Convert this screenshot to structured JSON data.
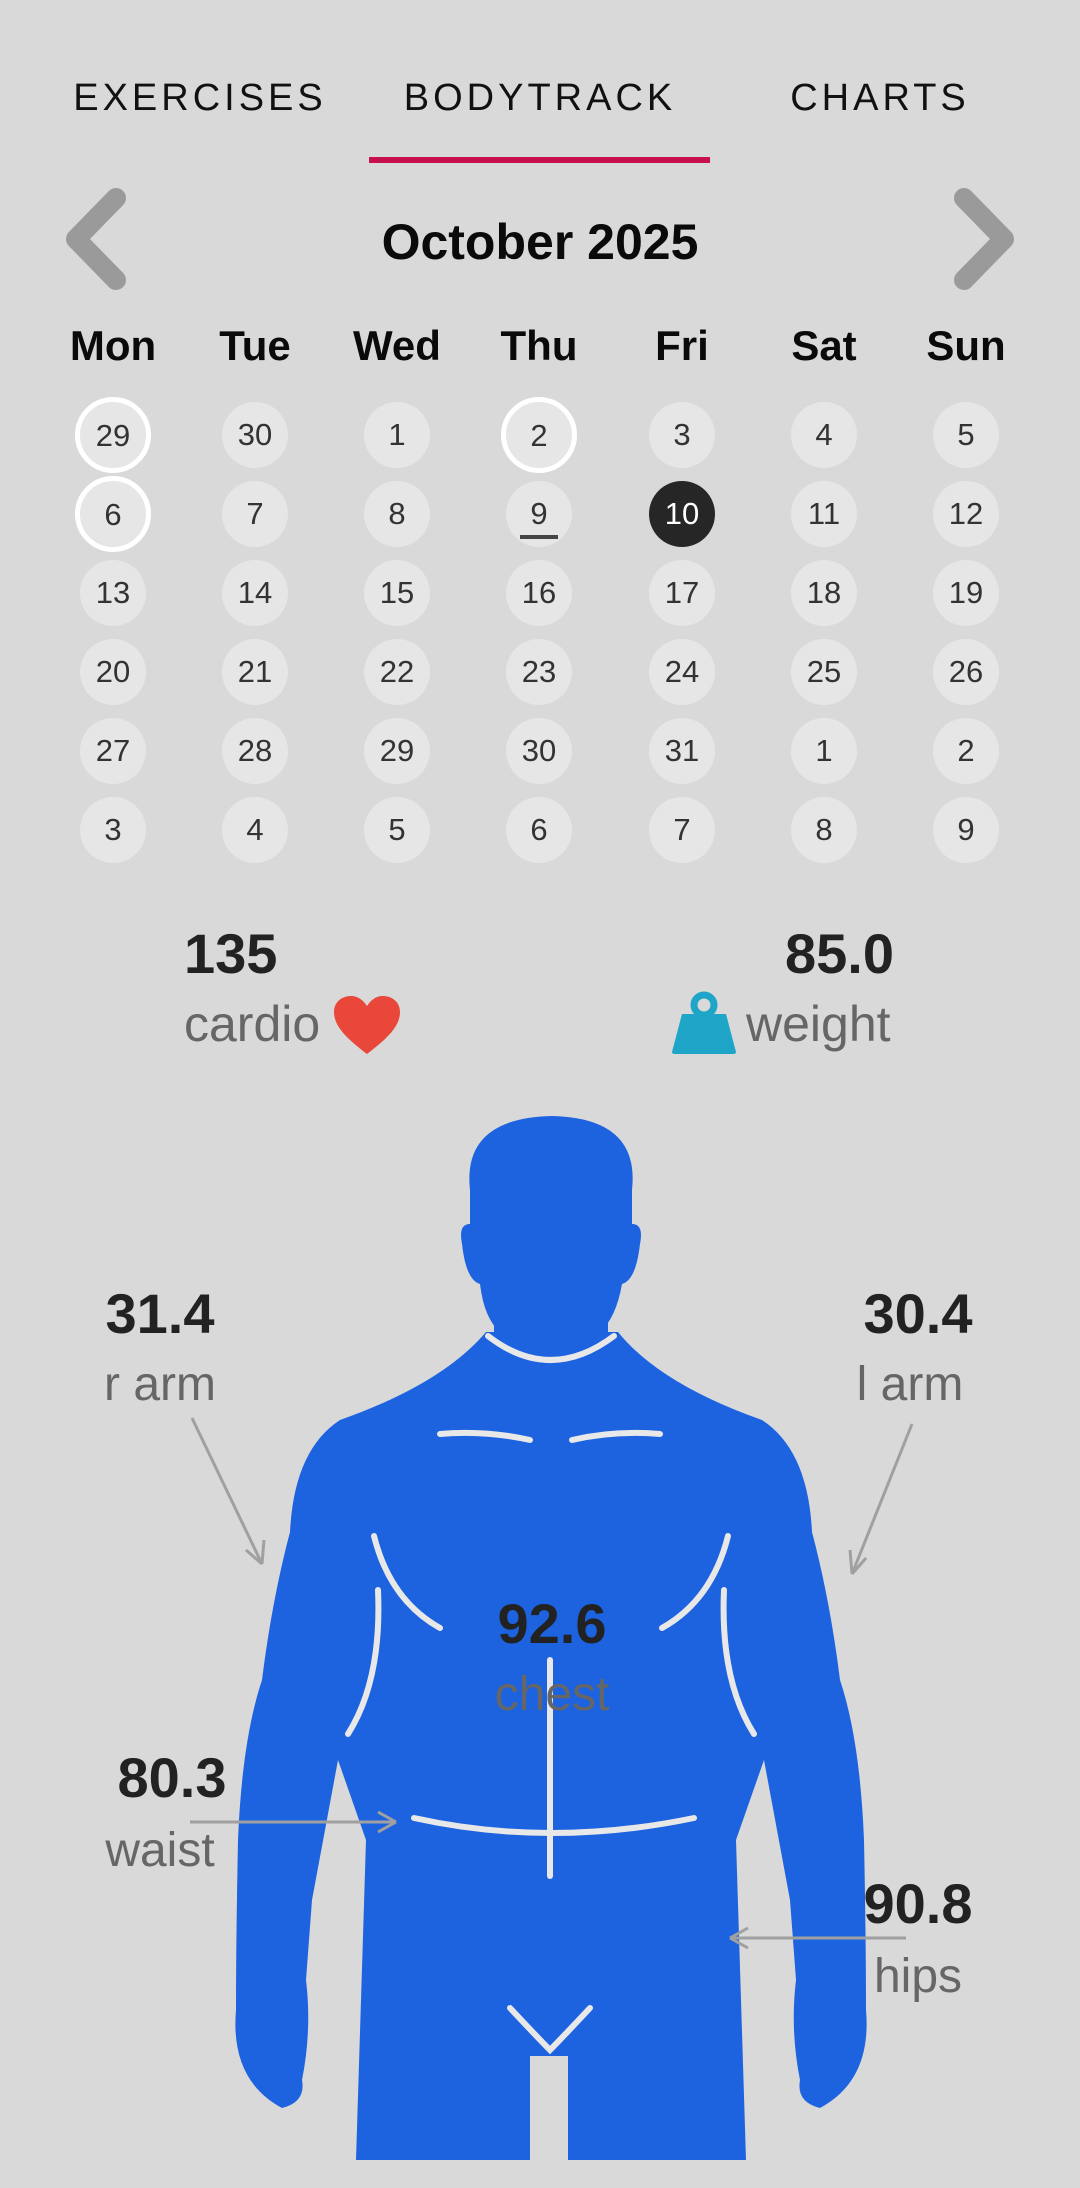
{
  "tabs": [
    {
      "label": "EXERCISES"
    },
    {
      "label": "BODYTRACK"
    },
    {
      "label": "CHARTS"
    }
  ],
  "active_tab": "BODYTRACK",
  "accent_color": "#c8104e",
  "calendar": {
    "month_title": "October 2025",
    "weekdays": [
      "Mon",
      "Tue",
      "Wed",
      "Thu",
      "Fri",
      "Sat",
      "Sun"
    ],
    "weeks": [
      [
        "29",
        "30",
        "1",
        "2",
        "3",
        "4",
        "5"
      ],
      [
        "6",
        "7",
        "8",
        "9",
        "10",
        "11",
        "12"
      ],
      [
        "13",
        "14",
        "15",
        "16",
        "17",
        "18",
        "19"
      ],
      [
        "20",
        "21",
        "22",
        "23",
        "24",
        "25",
        "26"
      ],
      [
        "27",
        "28",
        "29",
        "30",
        "31",
        "1",
        "2"
      ],
      [
        "3",
        "4",
        "5",
        "6",
        "7",
        "8",
        "9"
      ]
    ],
    "marked_days": [
      "29 (Sep)",
      "2",
      "6"
    ],
    "today": "9",
    "selected_day": "10"
  },
  "stats": {
    "cardio": {
      "value": "135",
      "label": "cardio",
      "icon": "heart-icon",
      "color": "#e8473a"
    },
    "weight": {
      "value": "85.0",
      "label": "weight",
      "icon": "kettlebell-icon",
      "color": "#1ea5c7"
    }
  },
  "body": {
    "color": "#1d63e0",
    "measurements": {
      "r_arm": {
        "value": "31.4",
        "label": "r arm"
      },
      "l_arm": {
        "value": "30.4",
        "label": "l arm"
      },
      "chest": {
        "value": "92.6",
        "label": "chest"
      },
      "waist": {
        "value": "80.3",
        "label": "waist"
      },
      "hips": {
        "value": "90.8",
        "label": "hips"
      }
    }
  }
}
